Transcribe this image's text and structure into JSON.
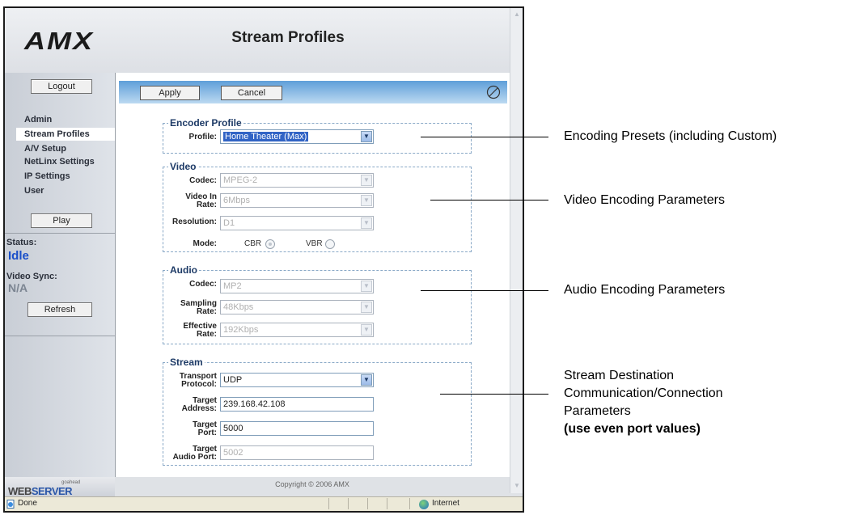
{
  "header": {
    "logo": "AMX",
    "title": "Stream Profiles"
  },
  "sidebar": {
    "logout_label": "Logout",
    "menu": [
      "Admin",
      "Stream Profiles",
      "A/V Setup",
      "NetLinx Settings",
      "IP Settings",
      "User"
    ],
    "active_item": "Stream Profiles",
    "play_label": "Play",
    "status_label": "Status:",
    "status_value": "Idle",
    "video_sync_label": "Video Sync:",
    "video_sync_value": "N/A",
    "refresh_label": "Refresh"
  },
  "toolbar": {
    "apply_label": "Apply",
    "cancel_label": "Cancel"
  },
  "encoder_profile": {
    "legend": "Encoder Profile",
    "profile_label": "Profile:",
    "profile_value": "Home Theater (Max)"
  },
  "video": {
    "legend": "Video",
    "codec_label": "Codec:",
    "codec_value": "MPEG-2",
    "rate_label_1": "Video In",
    "rate_label_2": "Rate:",
    "rate_value": "6Mbps",
    "resolution_label": "Resolution:",
    "resolution_value": "D1",
    "mode_label": "Mode:",
    "mode_cbr": "CBR",
    "mode_vbr": "VBR",
    "mode_selected": "CBR"
  },
  "audio": {
    "legend": "Audio",
    "codec_label": "Codec:",
    "codec_value": "MP2",
    "sampling_label_1": "Sampling",
    "sampling_label_2": "Rate:",
    "sampling_value": "48Kbps",
    "effective_label_1": "Effective",
    "effective_label_2": "Rate:",
    "effective_value": "192Kbps"
  },
  "stream": {
    "legend": "Stream",
    "transport_label_1": "Transport",
    "transport_label_2": "Protocol:",
    "transport_value": "UDP",
    "address_label_1": "Target",
    "address_label_2": "Address:",
    "address_value": "239.168.42.108",
    "port_label_1": "Target",
    "port_label_2": "Port:",
    "port_value": "5000",
    "audio_port_label_1": "Target",
    "audio_port_label_2": "Audio Port:",
    "audio_port_value": "5002"
  },
  "footer": {
    "copyright": "Copyright © 2006 AMX",
    "webserver_small": "goahead",
    "webserver_a": "WEB",
    "webserver_b": "SERVER"
  },
  "statusbar": {
    "done": "Done",
    "zone": "Internet"
  },
  "callouts": {
    "encoding_presets": "Encoding Presets (including Custom)",
    "video_params": "Video Encoding Parameters",
    "audio_params": "Audio Encoding Parameters",
    "stream_line1": "Stream Destination",
    "stream_line2": "Communication/Connection",
    "stream_line3": "Parameters",
    "stream_line4": "(use even port values)"
  },
  "icons": [
    "no-entry-icon",
    "dropdown-arrow-icon",
    "page-icon",
    "globe-icon",
    "scroll-up-icon",
    "scroll-down-icon"
  ],
  "colors": {
    "status_idle": "#1a4fc9",
    "status_na": "#7c8592",
    "toolbar": "#5f9fd9",
    "selection": "#3163c5"
  }
}
